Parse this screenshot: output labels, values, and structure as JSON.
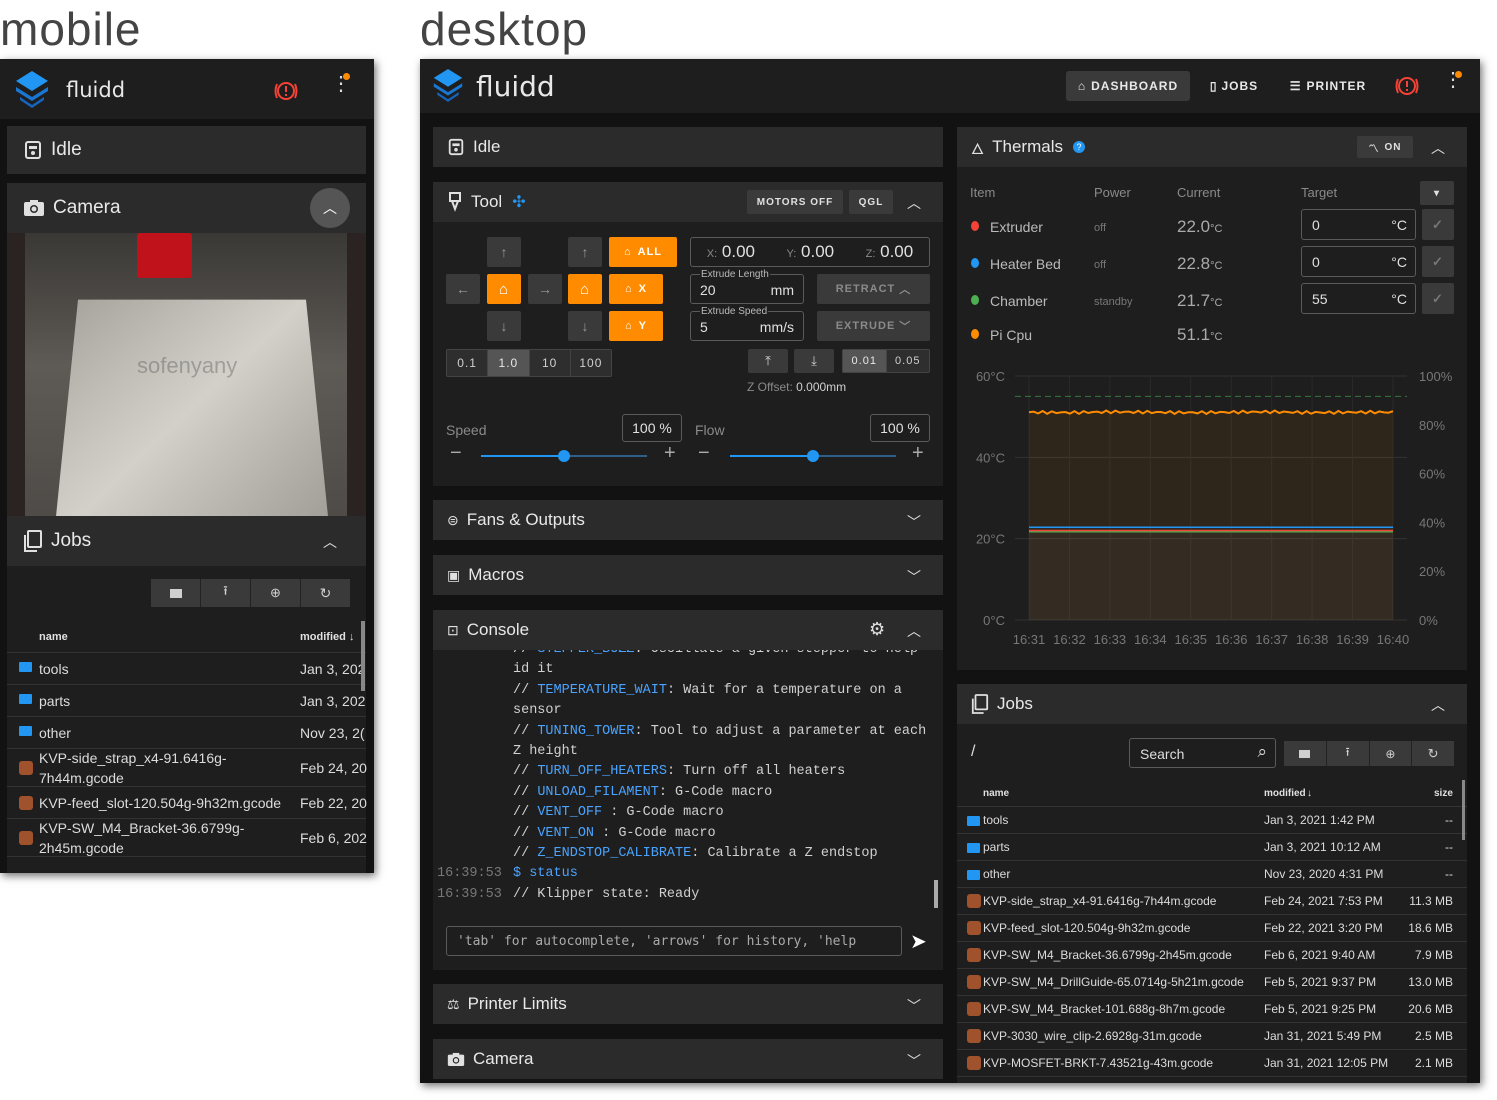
{
  "labels": {
    "mobile": "mobile",
    "desktop": "desktop"
  },
  "colors": {
    "accent": "#ff8c00",
    "primary": "#2196f3",
    "bg": "#121212",
    "card": "#1e1e1e",
    "header": "#2b2b2b",
    "alert": "#f44336"
  },
  "mobile": {
    "brand": "fluidd",
    "status": "Idle",
    "camera_title": "Camera",
    "camera_watermark": "sofenyany",
    "jobs_title": "Jobs",
    "jobs_columns": {
      "name": "name",
      "modified": "modified"
    },
    "jobs_rows": [
      {
        "type": "folder",
        "name": "tools",
        "modified": "Jan 3, 202"
      },
      {
        "type": "folder",
        "name": "parts",
        "modified": "Jan 3, 202"
      },
      {
        "type": "folder",
        "name": "other",
        "modified": "Nov 23, 2("
      },
      {
        "type": "file",
        "name": "KVP-side_strap_x4-91.6416g-",
        "name2": "7h44m.gcode",
        "modified": "Feb 24, 20"
      },
      {
        "type": "file",
        "name": "KVP-feed_slot-120.504g-9h32m.gcode",
        "modified": "Feb 22, 20"
      },
      {
        "type": "file",
        "name": "KVP-SW_M4_Bracket-36.6799g-",
        "name2": "2h45m.gcode",
        "modified": "Feb 6, 202"
      }
    ]
  },
  "desktop": {
    "brand": "fluidd",
    "nav": {
      "dashboard": "DASHBOARD",
      "jobs": "JOBS",
      "printer": "PRINTER"
    },
    "status": "Idle",
    "tool": {
      "title": "Tool",
      "motors_off": "MOTORS OFF",
      "qgl": "QGL",
      "home_all": "ALL",
      "home_x": "X",
      "home_y": "Y",
      "pos": {
        "x_label": "X:",
        "x": "0.00",
        "y_label": "Y:",
        "y": "0.00",
        "z_label": "Z:",
        "z": "0.00"
      },
      "extrude_length_label": "Extrude Length",
      "extrude_length": "20",
      "extrude_length_unit": "mm",
      "extrude_speed_label": "Extrude Speed",
      "extrude_speed": "5",
      "extrude_speed_unit": "mm/s",
      "retract": "RETRACT",
      "extrude": "EXTRUDE",
      "steps": [
        "0.1",
        "1.0",
        "10",
        "100"
      ],
      "z_steps": [
        "0.01",
        "0.05"
      ],
      "z_offset_label": "Z Offset:",
      "z_offset": "0.000mm",
      "speed_label": "Speed",
      "speed_value": "100 %",
      "speed_fraction": 0.5,
      "flow_label": "Flow",
      "flow_value": "100 %",
      "flow_fraction": 0.5
    },
    "fans_title": "Fans & Outputs",
    "macros_title": "Macros",
    "console": {
      "title": "Console",
      "lines": [
        {
          "time": "",
          "cmd": "// ",
          "kw": "STEPPER_BUZZ",
          "rest": ": Oscillate a given stepper to help"
        },
        {
          "time": "",
          "cmd": "",
          "kw": "",
          "rest": "id it"
        },
        {
          "time": "",
          "cmd": "// ",
          "kw": "TEMPERATURE_WAIT",
          "rest": ": Wait for a temperature on a"
        },
        {
          "time": "",
          "cmd": "",
          "kw": "",
          "rest": "sensor"
        },
        {
          "time": "",
          "cmd": "// ",
          "kw": "TUNING_TOWER",
          "rest": ": Tool to adjust a parameter at each"
        },
        {
          "time": "",
          "cmd": "",
          "kw": "",
          "rest": "Z height"
        },
        {
          "time": "",
          "cmd": "// ",
          "kw": "TURN_OFF_HEATERS",
          "rest": ": Turn off all heaters"
        },
        {
          "time": "",
          "cmd": "// ",
          "kw": "UNLOAD_FILAMENT",
          "rest": ": G-Code macro"
        },
        {
          "time": "",
          "cmd": "// ",
          "kw": "VENT_OFF",
          "rest": " : G-Code macro"
        },
        {
          "time": "",
          "cmd": "// ",
          "kw": "VENT_ON",
          "rest": " : G-Code macro"
        },
        {
          "time": "",
          "cmd": "// ",
          "kw": "Z_ENDSTOP_CALIBRATE",
          "rest": ": Calibrate a Z endstop"
        },
        {
          "time": "16:39:53",
          "cmd": "",
          "kw": "$ status",
          "rest": ""
        },
        {
          "time": "16:39:53",
          "cmd": "",
          "kw": "",
          "rest": "// Klipper state: Ready"
        }
      ],
      "input_placeholder": "'tab' for autocomplete, 'arrows' for history, 'help"
    },
    "limits_title": "Printer Limits",
    "camera_title": "Camera",
    "thermals": {
      "title": "Thermals",
      "toggle": "ON",
      "columns": {
        "item": "Item",
        "power": "Power",
        "current": "Current",
        "target": "Target"
      },
      "rows": [
        {
          "name": "Extruder",
          "icon": "flame-icon",
          "color": "#f44336",
          "power": "off",
          "current": "22.0",
          "unit": "°C",
          "target": "0",
          "target_unit": "°C"
        },
        {
          "name": "Heater Bed",
          "icon": "drop-icon",
          "color": "#2196f3",
          "power": "off",
          "current": "22.8",
          "unit": "°C",
          "target": "0",
          "target_unit": "°C"
        },
        {
          "name": "Chamber",
          "icon": "fan-icon",
          "color": "#4caf50",
          "power": "standby",
          "current": "21.7",
          "unit": "°C",
          "target": "55",
          "target_unit": "°C"
        },
        {
          "name": "Pi Cpu",
          "icon": "thermometer-icon",
          "color": "#ff8c00",
          "power": "",
          "current": "51.1",
          "unit": "°C",
          "target": "",
          "target_unit": ""
        }
      ]
    },
    "jobs": {
      "title": "Jobs",
      "path": "/",
      "search_placeholder": "Search",
      "columns": {
        "name": "name",
        "modified": "modified",
        "size": "size"
      },
      "rows": [
        {
          "type": "folder",
          "name": "tools",
          "modified": "Jan 3, 2021 1:42 PM",
          "size": "--"
        },
        {
          "type": "folder",
          "name": "parts",
          "modified": "Jan 3, 2021 10:12 AM",
          "size": "--"
        },
        {
          "type": "folder",
          "name": "other",
          "modified": "Nov 23, 2020 4:31 PM",
          "size": "--"
        },
        {
          "type": "file",
          "name": "KVP-side_strap_x4-91.6416g-7h44m.gcode",
          "modified": "Feb 24, 2021 7:53 PM",
          "size": "11.3 MB"
        },
        {
          "type": "file",
          "name": "KVP-feed_slot-120.504g-9h32m.gcode",
          "modified": "Feb 22, 2021 3:20 PM",
          "size": "18.6 MB"
        },
        {
          "type": "file",
          "name": "KVP-SW_M4_Bracket-36.6799g-2h45m.gcode",
          "modified": "Feb 6, 2021 9:40 AM",
          "size": "7.9 MB"
        },
        {
          "type": "file",
          "name": "KVP-SW_M4_DrillGuide-65.0714g-5h21m.gcode",
          "modified": "Feb 5, 2021 9:37 PM",
          "size": "13.0 MB"
        },
        {
          "type": "file",
          "name": "KVP-SW_M4_Bracket-101.688g-8h7m.gcode",
          "modified": "Feb 5, 2021 9:25 PM",
          "size": "20.6 MB"
        },
        {
          "type": "file",
          "name": "KVP-3030_wire_clip-2.6928g-31m.gcode",
          "modified": "Jan 31, 2021 5:49 PM",
          "size": "2.5 MB"
        },
        {
          "type": "file",
          "name": "KVP-MOSFET-BRKT-7.43521g-43m.gcode",
          "modified": "Jan 31, 2021 12:05 PM",
          "size": "2.1 MB"
        }
      ]
    }
  },
  "chart_data": {
    "type": "line",
    "x": [
      "16:31",
      "16:32",
      "16:33",
      "16:34",
      "16:35",
      "16:36",
      "16:37",
      "16:38",
      "16:39",
      "16:40"
    ],
    "y_left_ticks": [
      "60°C",
      "40°C",
      "20°C",
      "0°C"
    ],
    "y_right_ticks": [
      "100%",
      "80%",
      "60%",
      "40%",
      "20%",
      "0%"
    ],
    "ylim": [
      0,
      60
    ],
    "y2lim": [
      0,
      100
    ],
    "series": [
      {
        "color": "#ff8c00",
        "values": [
          51.1,
          51.0,
          51.2,
          51.1,
          51.0,
          51.1,
          51.2,
          51.0,
          51.1,
          51.1
        ]
      },
      {
        "color": "#2196f3",
        "values": [
          22.8,
          22.8,
          22.8,
          22.8,
          22.8,
          22.8,
          22.8,
          22.8,
          22.8,
          22.8
        ]
      },
      {
        "color": "#4caf50",
        "values": [
          21.7,
          21.7,
          21.7,
          21.7,
          21.7,
          21.7,
          21.7,
          21.7,
          21.7,
          21.7
        ]
      },
      {
        "color": "#f44336",
        "values": [
          22.0,
          22.0,
          22.0,
          22.0,
          22.0,
          22.0,
          22.0,
          22.0,
          22.0,
          22.0
        ]
      }
    ],
    "target_line": {
      "color": "#4caf50",
      "value": 55
    },
    "grid": true
  }
}
